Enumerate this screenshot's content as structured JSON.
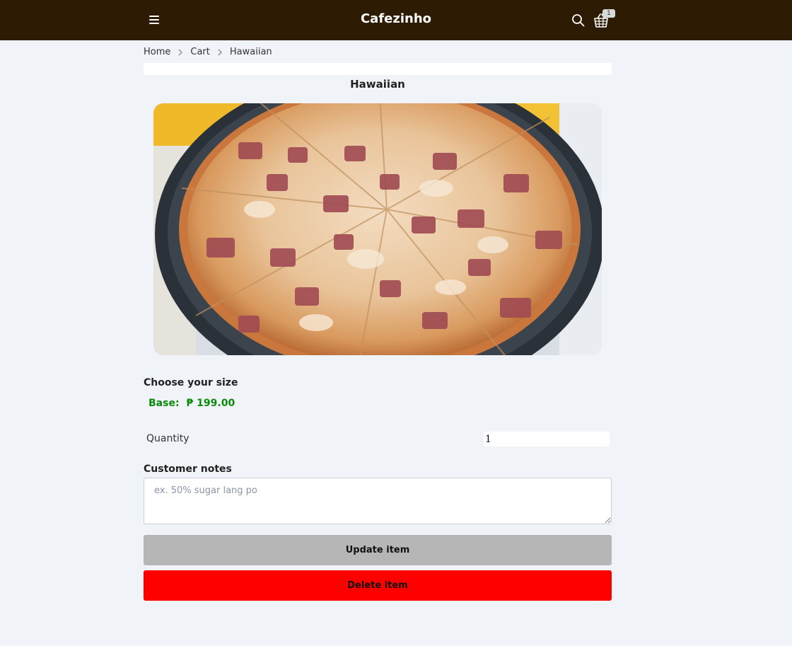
{
  "header": {
    "brand": "Cafezinho",
    "cart_count": "1",
    "icons": {
      "menu": "menu-icon",
      "search": "search-icon",
      "cart": "basket-icon"
    },
    "background_color": "#2e1b04"
  },
  "breadcrumb": {
    "items": [
      "Home",
      "Cart"
    ],
    "current": "Hawaiian"
  },
  "product": {
    "title": "Hawaiian",
    "image": "pizza-photo"
  },
  "size": {
    "label": "Choose your size",
    "option_name": "Base:",
    "option_price": "₱ 199.00",
    "price_color": "#0a8a0a"
  },
  "quantity": {
    "label": "Quantity",
    "value": "1"
  },
  "notes": {
    "label": "Customer notes",
    "placeholder": "ex. 50% sugar lang po"
  },
  "actions": {
    "update_label": "Update item",
    "delete_label": "Delete item",
    "update_color": "#b6b6b6",
    "delete_color": "#ff0000"
  }
}
